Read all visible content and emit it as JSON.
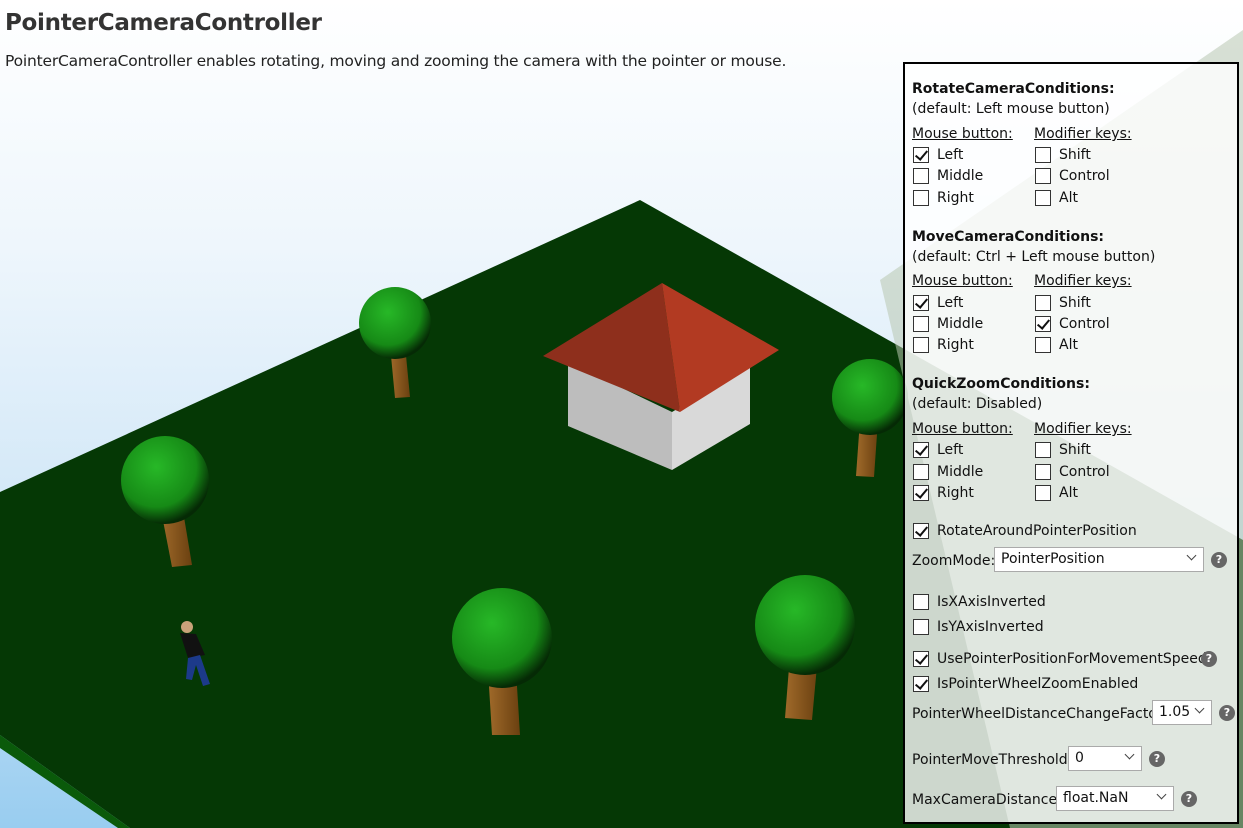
{
  "page": {
    "title": "PointerCameraController",
    "subtitle": "PointerCameraController enables rotating, moving and zooming the camera with the pointer or mouse."
  },
  "labels": {
    "mouse_button": "Mouse button:",
    "modifier_keys": "Modifier keys:",
    "left": "Left",
    "middle": "Middle",
    "right": "Right",
    "shift": "Shift",
    "control": "Control",
    "alt": "Alt"
  },
  "rotate": {
    "title": "RotateCameraConditions:",
    "default": "(default: Left mouse button)",
    "left": true,
    "middle": false,
    "right": false,
    "shift": false,
    "control": false,
    "alt": false
  },
  "move": {
    "title": "MoveCameraConditions:",
    "default": "(default: Ctrl + Left mouse button)",
    "left": true,
    "middle": false,
    "right": false,
    "shift": false,
    "control": true,
    "alt": false
  },
  "quickzoom": {
    "title": "QuickZoomConditions:",
    "default": "(default: Disabled)",
    "left": true,
    "middle": false,
    "right": true,
    "shift": false,
    "control": false,
    "alt": false
  },
  "options": {
    "rotate_around_pointer": {
      "label": "RotateAroundPointerPosition",
      "checked": true
    },
    "zoom_mode": {
      "label": "ZoomMode:",
      "value": "PointerPosition"
    },
    "x_inverted": {
      "label": "IsXAxisInverted",
      "checked": false
    },
    "y_inverted": {
      "label": "IsYAxisInverted",
      "checked": false
    },
    "pointer_speed": {
      "label": "UsePointerPositionForMovementSpeed",
      "checked": true
    },
    "wheel_zoom": {
      "label": "IsPointerWheelZoomEnabled",
      "checked": true
    },
    "wheel_factor": {
      "label": "PointerWheelDistanceChangeFactor:",
      "value": "1.05"
    },
    "move_threshold": {
      "label": "PointerMoveThreshold:",
      "value": "0"
    },
    "max_distance": {
      "label": "MaxCameraDistance:",
      "value": "float.NaN"
    }
  },
  "help_glyph": "?",
  "colors": {
    "ground": "#053805",
    "roof": "#8c3220",
    "walls": "#c4c4c4",
    "foliage": "#1a9a1a",
    "trunk": "#8b5a20"
  }
}
